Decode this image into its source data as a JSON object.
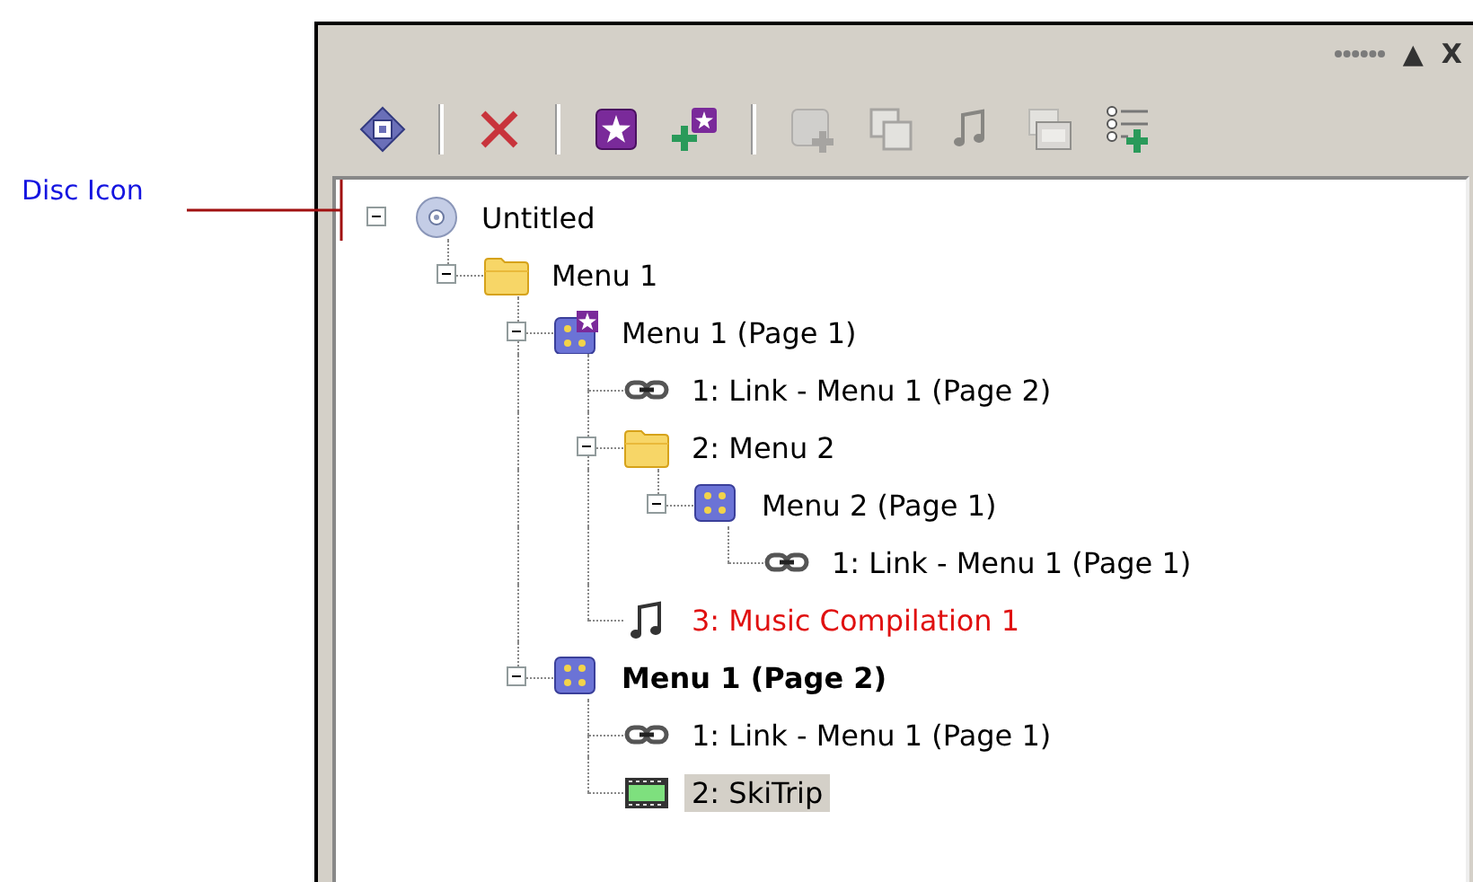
{
  "annotation": {
    "label": "Disc Icon"
  },
  "panel": {
    "title_controls": [
      "▲",
      "X"
    ]
  },
  "toolbar": {
    "groups": [
      [
        {
          "kind": "target",
          "disabled": false
        }
      ],
      [
        {
          "kind": "delete",
          "disabled": false
        }
      ],
      [
        {
          "kind": "star-menu",
          "disabled": false
        },
        {
          "kind": "add-star",
          "disabled": false
        }
      ],
      [
        {
          "kind": "add-image",
          "disabled": true
        },
        {
          "kind": "pages",
          "disabled": true
        },
        {
          "kind": "music",
          "disabled": true
        },
        {
          "kind": "film",
          "disabled": true
        },
        {
          "kind": "add-list",
          "disabled": false
        }
      ]
    ]
  },
  "tree": [
    {
      "kind": "disc",
      "label": "Untitled",
      "expanded": true,
      "selected": false,
      "bold": false,
      "warning": false,
      "children": [
        {
          "kind": "folder",
          "label": "Menu 1",
          "expanded": true,
          "selected": false,
          "bold": false,
          "warning": false,
          "children": [
            {
              "kind": "menu-star",
              "label": "Menu 1 (Page 1)",
              "expanded": true,
              "selected": false,
              "bold": false,
              "warning": false,
              "children": [
                {
                  "kind": "link",
                  "label": "1: Link - Menu 1 (Page 2)",
                  "selected": false,
                  "bold": false,
                  "warning": false
                },
                {
                  "kind": "folder",
                  "label": "2: Menu 2",
                  "expanded": true,
                  "selected": false,
                  "bold": false,
                  "warning": false,
                  "children": [
                    {
                      "kind": "menu",
                      "label": "Menu 2 (Page 1)",
                      "expanded": true,
                      "selected": false,
                      "bold": false,
                      "warning": false,
                      "children": [
                        {
                          "kind": "link",
                          "label": "1: Link - Menu 1 (Page 1)",
                          "selected": false,
                          "bold": false,
                          "warning": false
                        }
                      ]
                    }
                  ]
                },
                {
                  "kind": "music",
                  "label": "3: Music Compilation 1",
                  "selected": false,
                  "bold": false,
                  "warning": true
                }
              ]
            },
            {
              "kind": "menu",
              "label": "Menu 1 (Page 2)",
              "expanded": true,
              "selected": false,
              "bold": true,
              "warning": false,
              "children": [
                {
                  "kind": "link",
                  "label": "1: Link - Menu 1 (Page 1)",
                  "selected": false,
                  "bold": false,
                  "warning": false
                },
                {
                  "kind": "video",
                  "label": "2: SkiTrip",
                  "selected": true,
                  "bold": false,
                  "warning": false
                }
              ]
            }
          ]
        }
      ]
    }
  ]
}
